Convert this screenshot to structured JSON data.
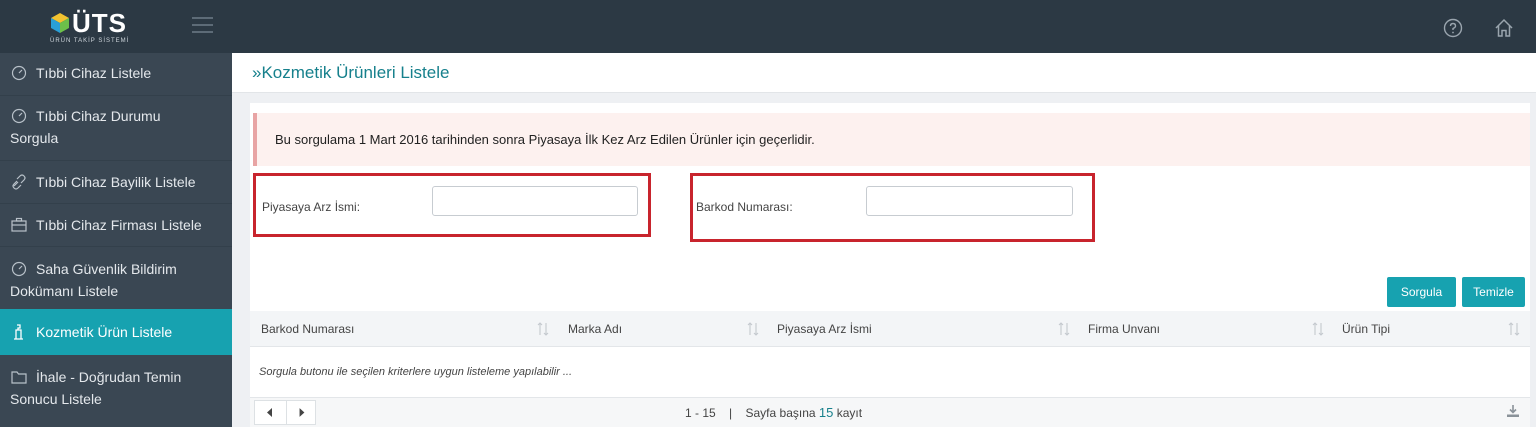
{
  "header": {
    "logo_text": "ÜTS",
    "logo_subtitle": "ÜRÜN TAKİP SİSTEMİ",
    "icons": [
      "help-icon",
      "home-icon",
      "menu-icon"
    ]
  },
  "sidebar": {
    "items": [
      {
        "label": "Tıbbi Cihaz Listele",
        "icon": "gauge-icon"
      },
      {
        "label": "Tıbbi Cihaz Durumu Sorgula",
        "icon": "gauge-icon"
      },
      {
        "label": "Tıbbi Cihaz Bayilik Listele",
        "icon": "link-icon"
      },
      {
        "label": "Tıbbi Cihaz Firması Listele",
        "icon": "briefcase-icon"
      },
      {
        "label": "Saha Güvenlik Bildirim Dokümanı Listele",
        "icon": "gauge-icon"
      },
      {
        "label": "Kozmetik Ürün Listele",
        "icon": "cosmetic-icon",
        "active": true
      },
      {
        "label": "İhale - Doğrudan Temin Sonucu Listele",
        "icon": "folder-icon"
      }
    ]
  },
  "page": {
    "title": "»Kozmetik Ürünleri Listele"
  },
  "alert": {
    "text": "Bu sorgulama 1 Mart 2016 tarihinden sonra Piyasaya İlk Kez Arz Edilen Ürünler için geçerlidir."
  },
  "filters": {
    "piyasaya_label": "Piyasaya Arz İsmi:",
    "piyasaya_value": "",
    "barkod_label": "Barkod Numarası:",
    "barkod_value": ""
  },
  "buttons": {
    "query": "Sorgula",
    "clear": "Temizle"
  },
  "table": {
    "columns": [
      "Barkod Numarası",
      "Marka Adı",
      "Piyasaya Arz İsmi",
      "Firma Unvanı",
      "Ürün Tipi"
    ],
    "empty_message": "Sorgula butonu ile seçilen kriterlere uygun listeleme yapılabilir ..."
  },
  "pager": {
    "range": "1 - 15",
    "separator": "|",
    "per_page_prefix": "Sayfa başına",
    "per_page_value": "15",
    "per_page_suffix": "kayıt"
  },
  "colors": {
    "topbar": "#2c3944",
    "sidebar": "#3a4753",
    "accent": "#17a2b0",
    "highlight_border": "#c8242d",
    "alert_bg": "#fdf1ef"
  }
}
